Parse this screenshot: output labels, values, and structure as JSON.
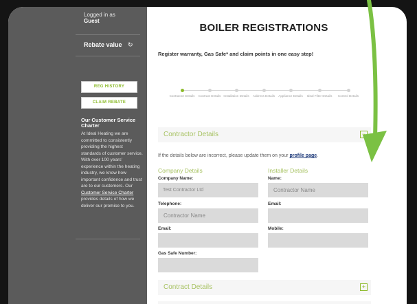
{
  "sidebar": {
    "logged_in_label": "Logged in as",
    "user": "Guest",
    "rebate_label": "Rebate value",
    "rebate_icon": "refresh-icon",
    "buttons": [
      "REG HISTORY",
      "CLAIM REBATE"
    ],
    "charter_title": "Our Customer Service Charter",
    "charter_text_before": "At Ideal Heating we are committed to consistently providing the highest standards of customer service. With over 100 years' experience within the heating industry, we know how important confidence and trust are to our customers. Our ",
    "charter_link": "Customer Service Charter",
    "charter_text_after": " provides details of how we deliver our promise to you."
  },
  "main": {
    "title": "BOILER REGISTRATIONS",
    "subtitle": "Register warranty, Gas Safe* and claim points in one easy step!",
    "steps": [
      {
        "label": "Contractor Details",
        "active": true
      },
      {
        "label": "Contract Details",
        "active": false
      },
      {
        "label": "Installation Details",
        "active": false
      },
      {
        "label": "Address Details",
        "active": false
      },
      {
        "label": "Appliance Details",
        "active": false
      },
      {
        "label": "Ideal Filter Details",
        "active": false
      },
      {
        "label": "Control Details",
        "active": false
      }
    ],
    "contractor_section": {
      "title": "Contractor Details",
      "toggle_icon": "minus-icon",
      "info_text": "If the details below are incorrect, please update them on your ",
      "info_link": "profile page",
      "info_end": ".",
      "company": {
        "title": "Company Details",
        "name_label": "Company Name:",
        "name_value": "Test Contractor Ltd",
        "telephone_label": "Telephone:",
        "telephone_value": "Contractor Name",
        "email_label": "Email:",
        "email_value": "",
        "gas_safe_label": "Gas Safe Number:",
        "gas_safe_value": ""
      },
      "installer": {
        "title": "Installer Details",
        "name_label": "Name:",
        "name_value": "Contractor Name",
        "email_label": "Email:",
        "email_value": "",
        "mobile_label": "Mobile:",
        "mobile_value": ""
      }
    },
    "contract_section": {
      "title": "Contract Details",
      "toggle_icon": "plus-icon"
    }
  },
  "colors": {
    "accent": "#8dbb2c",
    "sidebar": "#5b5b5b",
    "arrow": "#7bc143"
  }
}
